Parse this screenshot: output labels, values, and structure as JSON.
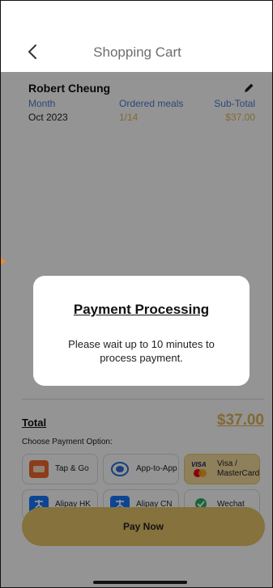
{
  "header": {
    "title": "Shopping Cart"
  },
  "user": {
    "name": "Robert Cheung",
    "stats": [
      {
        "label": "Month",
        "value": "Oct 2023"
      },
      {
        "label": "Ordered meals",
        "value": "1/14"
      },
      {
        "label": "Sub-Total",
        "value": "$37.00"
      }
    ]
  },
  "summary": {
    "total_label": "Total",
    "total_value": "$37.00",
    "choose_label": "Choose Payment Option:"
  },
  "payment_options": [
    {
      "label": "Tap & Go",
      "icon": "tapgo-icon",
      "color": "#f06a2c",
      "selected": false
    },
    {
      "label": "App-to-App",
      "icon": "fps-icon",
      "color": "#2a6fd6",
      "selected": false
    },
    {
      "label": "Visa / MasterCard",
      "icon": "visa-mastercard-icon",
      "color": "#1a1f71",
      "selected": true
    },
    {
      "label": "Alipay HK",
      "icon": "alipay-icon",
      "color": "#1677ff",
      "selected": false
    },
    {
      "label": "Alipay CN",
      "icon": "alipay-icon",
      "color": "#1677ff",
      "selected": false
    },
    {
      "label": "Wechat",
      "icon": "wechat-icon",
      "color": "#2aae67",
      "selected": false
    }
  ],
  "pay_button": {
    "label": "Pay Now"
  },
  "modal": {
    "title": "Payment Processing",
    "message": "Please wait up to 10 minutes to process payment."
  },
  "colors": {
    "accent": "#e0b55a",
    "link": "#4a7bd0"
  }
}
